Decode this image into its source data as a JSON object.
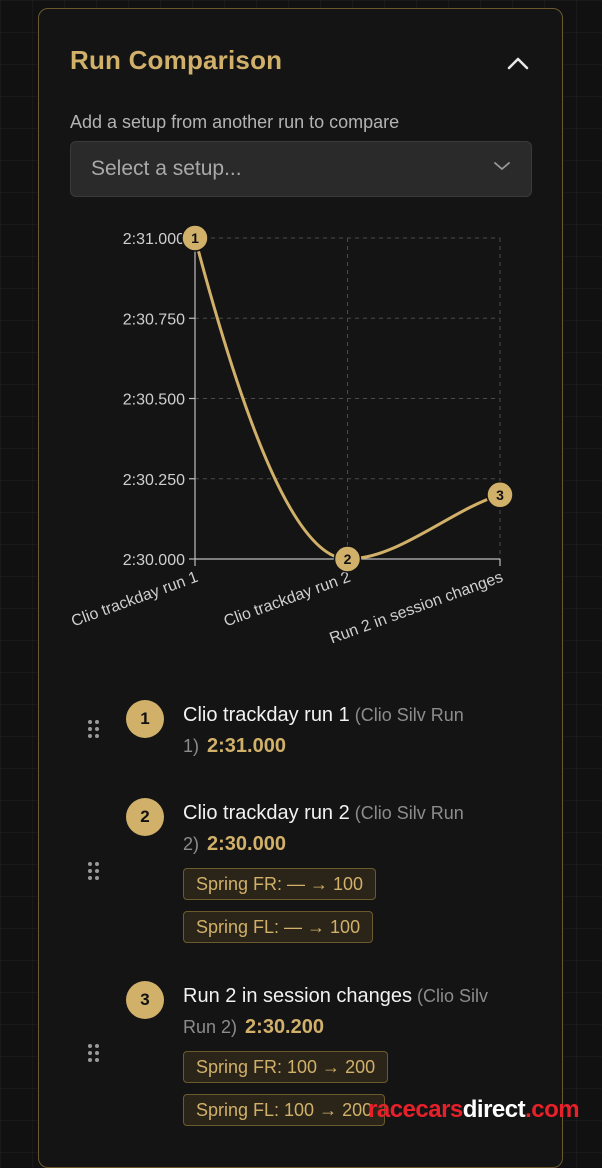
{
  "panel": {
    "title": "Run Comparison",
    "collapse_icon": "chevron-up-icon",
    "help_text": "Add a setup from another run to compare",
    "select_placeholder": "Select a setup...",
    "select_icon": "chevron-down-icon"
  },
  "colors": {
    "accent": "#d1b06a",
    "background": "#111111",
    "card": "#141414",
    "chip_bg": "#2a2518",
    "chip_border": "#6b5a2e"
  },
  "chart_data": {
    "type": "line",
    "categories": [
      "Clio trackday run 1",
      "Clio trackday run 2",
      "Run 2 in session changes"
    ],
    "series": [
      {
        "values": [
          151.0,
          150.0,
          150.2
        ],
        "point_labels": [
          "1",
          "2",
          "3"
        ]
      }
    ],
    "y_ticks": [
      "2:31.000",
      "2:30.750",
      "2:30.500",
      "2:30.250",
      "2:30.000"
    ],
    "y_tick_values": [
      151.0,
      150.75,
      150.5,
      150.25,
      150.0
    ],
    "ylim": [
      150.0,
      151.0
    ],
    "grid": true,
    "line_style": "smooth"
  },
  "runs": [
    {
      "badge": "1",
      "name": "Clio trackday run 1",
      "sub_line1": "(Clio Silv Run",
      "sub_line2": "1)",
      "time": "2:31.000",
      "changes": []
    },
    {
      "badge": "2",
      "name": "Clio trackday run 2",
      "sub_line1": "(Clio Silv Run",
      "sub_line2": "2)",
      "time": "2:30.000",
      "changes": [
        "Spring FR: — → 100",
        "Spring FL: — → 100"
      ]
    },
    {
      "badge": "3",
      "name": "Run 2 in session changes",
      "sub_line1": "(Clio Silv",
      "sub_line2": "Run 2)",
      "time": "2:30.200",
      "changes": [
        "Spring FR: 100 → 200",
        "Spring FL: 100 → 200"
      ]
    }
  ],
  "watermark": {
    "part1": "racecars",
    "part2": "direct",
    "part3": ".com"
  }
}
